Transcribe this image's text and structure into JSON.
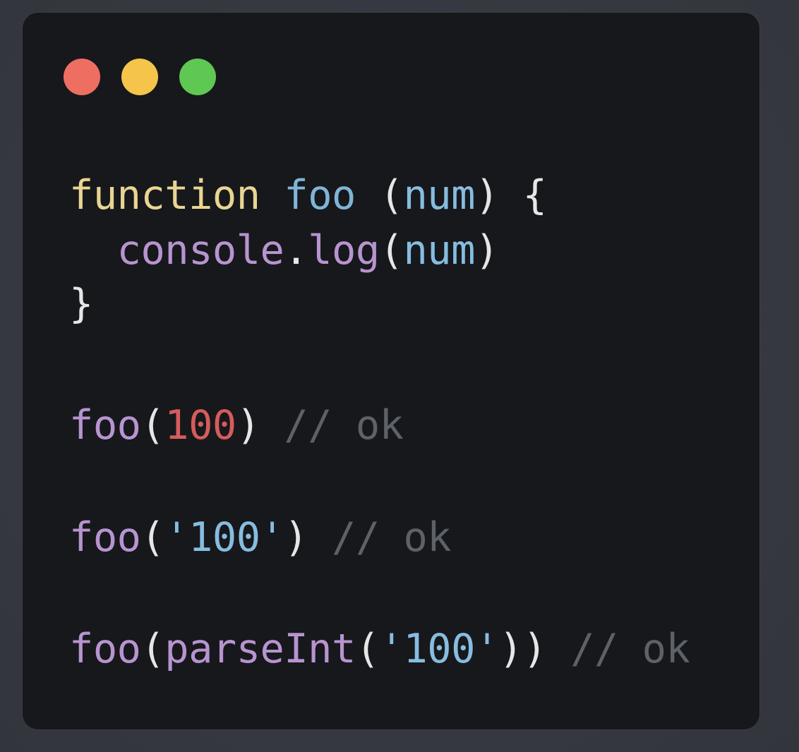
{
  "window": {
    "traffic_lights": [
      {
        "name": "close",
        "color": "#ee6f62"
      },
      {
        "name": "minimize",
        "color": "#f5c44a"
      },
      {
        "name": "maximize",
        "color": "#5fc852"
      }
    ]
  },
  "colors": {
    "keyword": "#e9d592",
    "function_name": "#7fb5d6",
    "punctuation": "#e6e6e6",
    "param": "#86bde0",
    "call": "#b794cf",
    "number": "#d65c5c",
    "string": "#86bde0",
    "comment": "#5d6168"
  },
  "code": {
    "line1": {
      "keyword": "function",
      "sp1": " ",
      "name": "foo",
      "sp2": " ",
      "open_paren": "(",
      "param": "num",
      "close_paren": ")",
      "sp3": " ",
      "open_brace": "{"
    },
    "line2": {
      "indent": "  ",
      "object": "console",
      "dot": ".",
      "method": "log",
      "open_paren": "(",
      "arg": "num",
      "close_paren": ")"
    },
    "line3": {
      "close_brace": "}"
    },
    "line4": {
      "call": "foo",
      "open_paren": "(",
      "arg": "100",
      "close_paren": ")",
      "sp": " ",
      "comment": "// ok"
    },
    "line5": {
      "call": "foo",
      "open_paren": "(",
      "arg": "'100'",
      "close_paren": ")",
      "sp": " ",
      "comment": "// ok"
    },
    "line6": {
      "call": "foo",
      "open_paren": "(",
      "inner_call": "parseInt",
      "inner_open_paren": "(",
      "arg": "'100'",
      "close_parens": "))",
      "sp": " ",
      "comment": "// ok"
    }
  }
}
